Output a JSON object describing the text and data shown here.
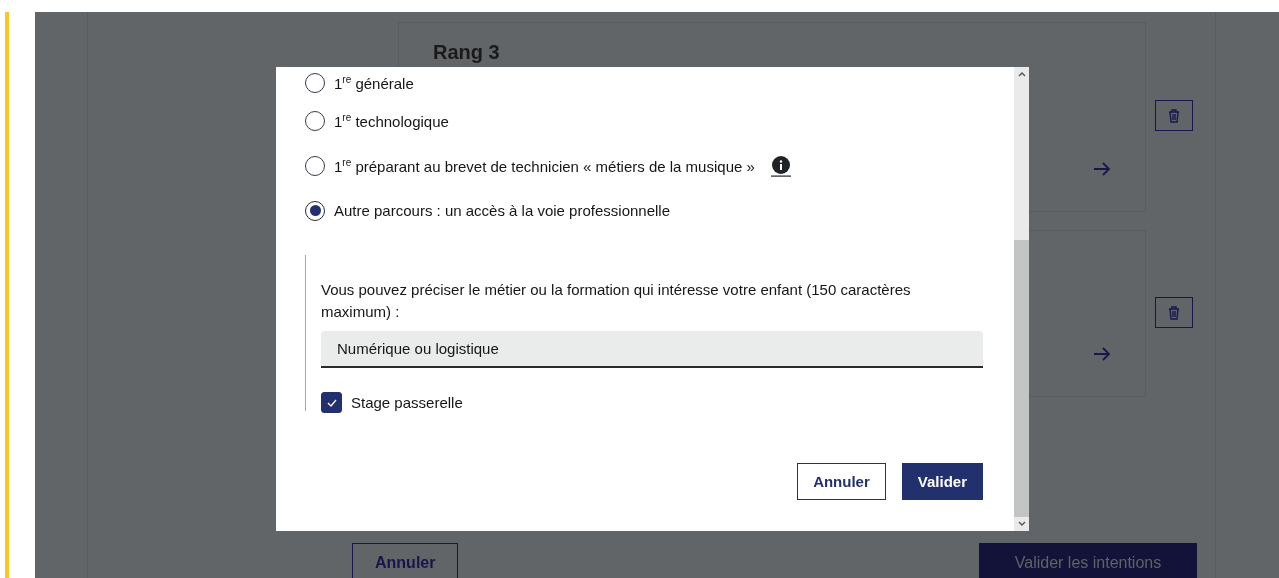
{
  "background_page": {
    "cards": [
      {
        "kind": "titled",
        "title": "Rang 3"
      },
      {
        "kind": "plain"
      }
    ],
    "buttons": [
      {
        "label": "Annuler",
        "kind": "secondary"
      },
      {
        "label": "Valider les intentions",
        "kind": "primary"
      }
    ]
  },
  "modal": {
    "options": [
      {
        "label": "1$^{re}$ générale",
        "selected": false,
        "info": false
      },
      {
        "label": "1$^{re}$ technologique",
        "selected": false,
        "info": false
      },
      {
        "label": "1$^{re}$ préparant au brevet de technicien « métiers de la musique »",
        "selected": false,
        "info": true
      },
      {
        "label": "Autre parcours : un accès à la voie professionnelle",
        "selected": true,
        "info": false
      }
    ],
    "detail": {
      "label": "Vous pouvez préciser le métier ou la formation qui intéresse votre enfant (150 caractères maximum) :",
      "value": "Numérique ou logistique"
    },
    "checkbox": {
      "label": "Stage passerelle",
      "checked": true
    },
    "buttons": [
      {
        "label": "Annuler",
        "kind": "secondary"
      },
      {
        "label": "Valider",
        "kind": "primary"
      }
    ]
  }
}
